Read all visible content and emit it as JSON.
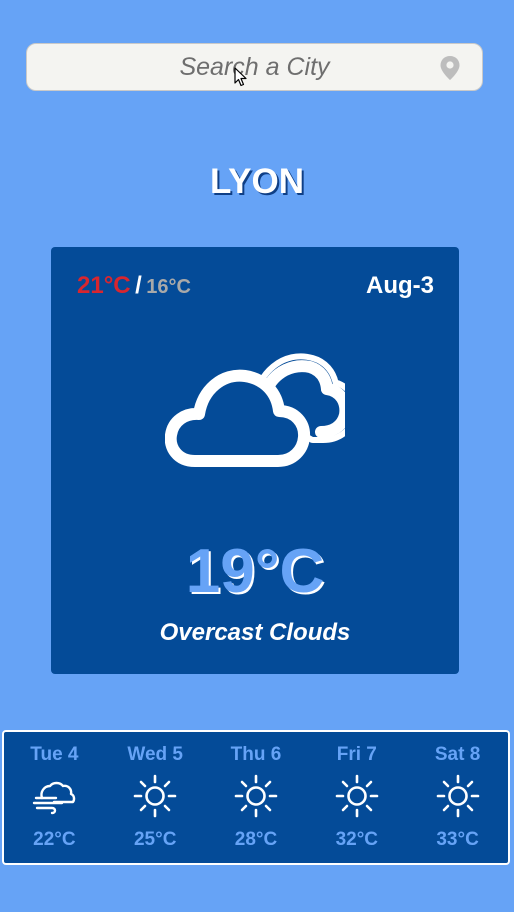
{
  "search": {
    "placeholder": "Search a City",
    "value": ""
  },
  "city": {
    "name": "LYON"
  },
  "current": {
    "high": "21°C",
    "separator": "/",
    "low": "16°C",
    "date": "Aug-3",
    "temperature": "19°C",
    "description": "Overcast Clouds",
    "icon": "overcast-clouds-icon"
  },
  "forecast": [
    {
      "day": "Tue 4",
      "temp": "22°C",
      "icon": "wind-cloud-icon"
    },
    {
      "day": "Wed 5",
      "temp": "25°C",
      "icon": "sun-icon"
    },
    {
      "day": "Thu 6",
      "temp": "28°C",
      "icon": "sun-icon"
    },
    {
      "day": "Fri 7",
      "temp": "32°C",
      "icon": "sun-icon"
    },
    {
      "day": "Sat 8",
      "temp": "33°C",
      "icon": "sun-icon"
    }
  ],
  "colors": {
    "background": "#66a3f6",
    "card": "#044b98",
    "high_temp": "#d8262f",
    "low_temp": "#a9a9a9",
    "accent": "#66a3f6"
  }
}
